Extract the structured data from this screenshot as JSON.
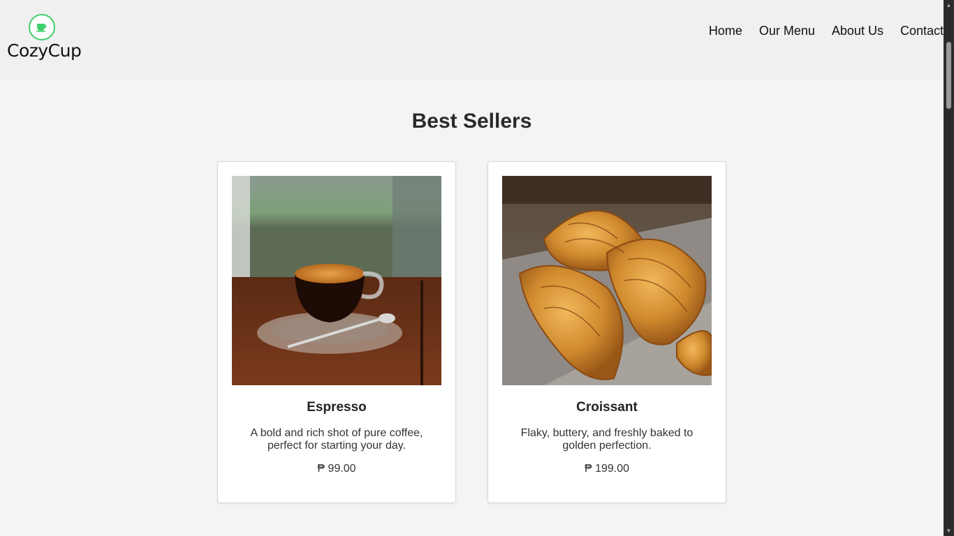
{
  "header": {
    "brand": "CozyCup",
    "nav": [
      {
        "label": "Home"
      },
      {
        "label": "Our Menu"
      },
      {
        "label": "About Us"
      },
      {
        "label": "Contact"
      }
    ]
  },
  "main": {
    "title": "Best Sellers",
    "products": [
      {
        "name": "Espresso",
        "description": "A bold and rich shot of pure coffee, perfect for starting your day.",
        "price": "₱ 99.00",
        "image_icon": "espresso-photo"
      },
      {
        "name": "Croissant",
        "description": "Flaky, buttery, and freshly baked to golden perfection.",
        "price": "₱ 199.00",
        "image_icon": "croissant-photo"
      }
    ]
  },
  "colors": {
    "accent": "#3fcf6a",
    "header_bg": "#f0f0f0",
    "page_bg": "#f4f4f4"
  }
}
